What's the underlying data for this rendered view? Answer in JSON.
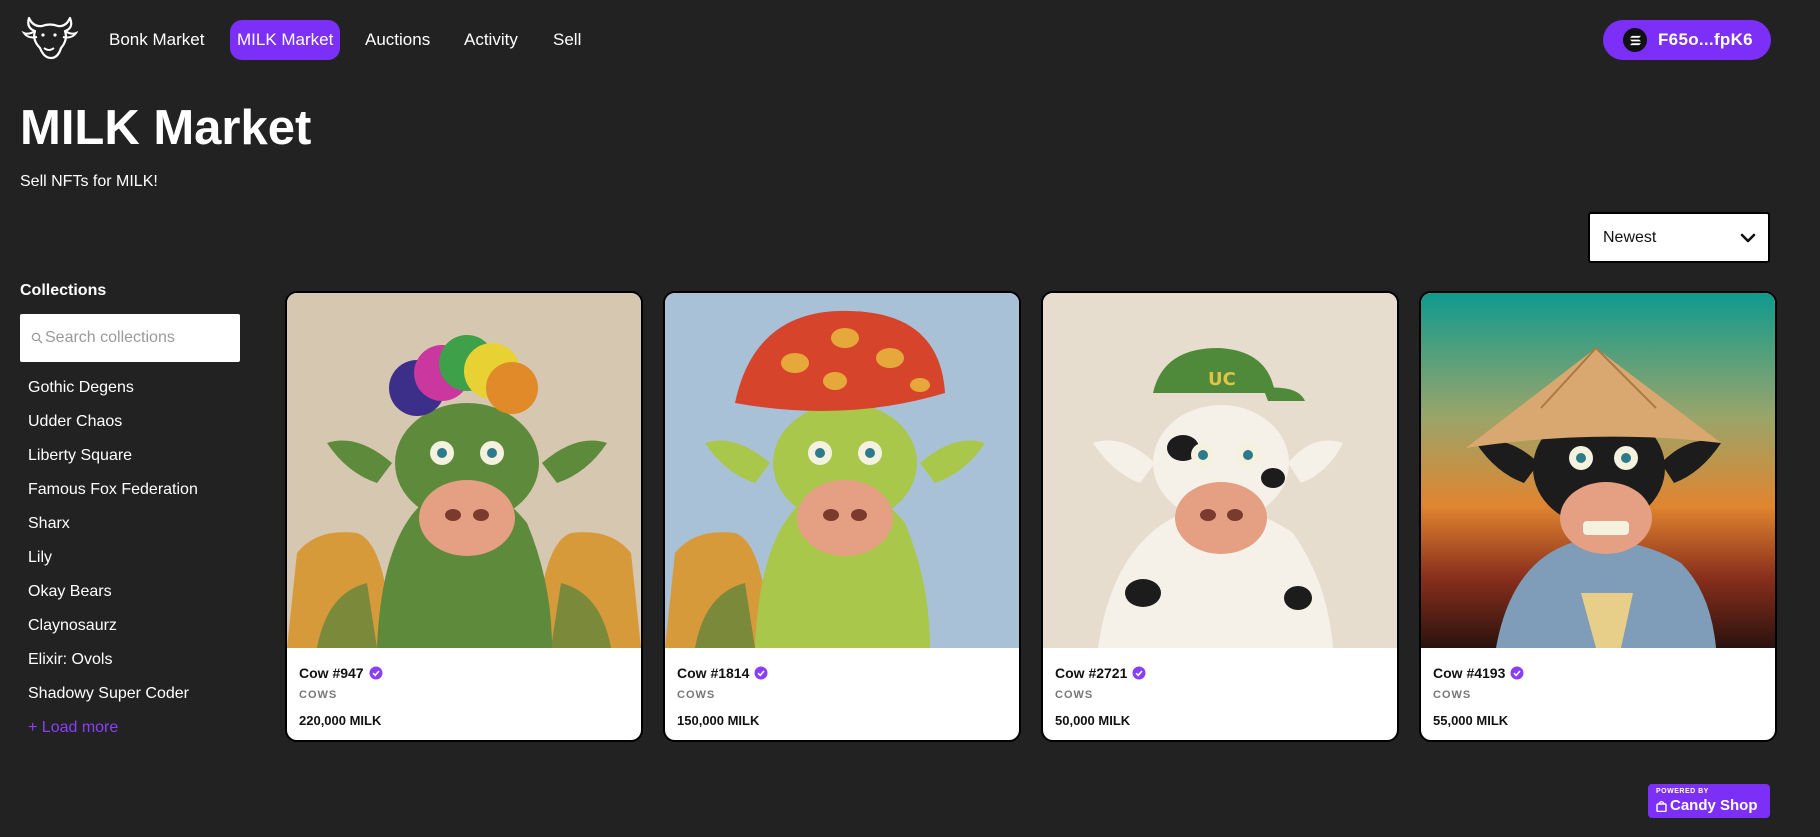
{
  "nav": {
    "items": [
      {
        "label": "Bonk Market",
        "active": false
      },
      {
        "label": "MILK Market",
        "active": true
      },
      {
        "label": "Auctions",
        "active": false
      },
      {
        "label": "Activity",
        "active": false
      },
      {
        "label": "Sell",
        "active": false
      }
    ],
    "wallet": {
      "label": "F65o...fpK6",
      "icon": "solana-icon"
    }
  },
  "header": {
    "title": "MILK Market",
    "subtitle": "Sell NFTs for MILK!"
  },
  "sort": {
    "selected": "Newest",
    "icon": "chevron-down-icon"
  },
  "sidebar": {
    "title": "Collections",
    "search_placeholder": "Search collections",
    "search_value": "",
    "items": [
      {
        "label": "Gothic Degens"
      },
      {
        "label": "Udder Chaos"
      },
      {
        "label": "Liberty Square"
      },
      {
        "label": "Famous Fox Federation"
      },
      {
        "label": "Sharx"
      },
      {
        "label": "Lily"
      },
      {
        "label": "Okay Bears"
      },
      {
        "label": "Claynosaurz"
      },
      {
        "label": "Elixir: Ovols"
      },
      {
        "label": "Shadowy Super Coder"
      }
    ],
    "load_more": "+ Load more"
  },
  "cards": [
    {
      "name": "Cow #947",
      "collection": "COWS",
      "price": "220,000 MILK",
      "verified": true
    },
    {
      "name": "Cow #1814",
      "collection": "COWS",
      "price": "150,000 MILK",
      "verified": true
    },
    {
      "name": "Cow #2721",
      "collection": "COWS",
      "price": "50,000 MILK",
      "verified": true
    },
    {
      "name": "Cow #4193",
      "collection": "COWS",
      "price": "55,000 MILK",
      "verified": true
    }
  ],
  "powered_by": {
    "top": "POWERED BY",
    "brand": "Candy Shop"
  },
  "colors": {
    "background": "#222222",
    "accent": "#7b2ff7",
    "card": "#ffffff",
    "link": "#8b3ef8"
  }
}
